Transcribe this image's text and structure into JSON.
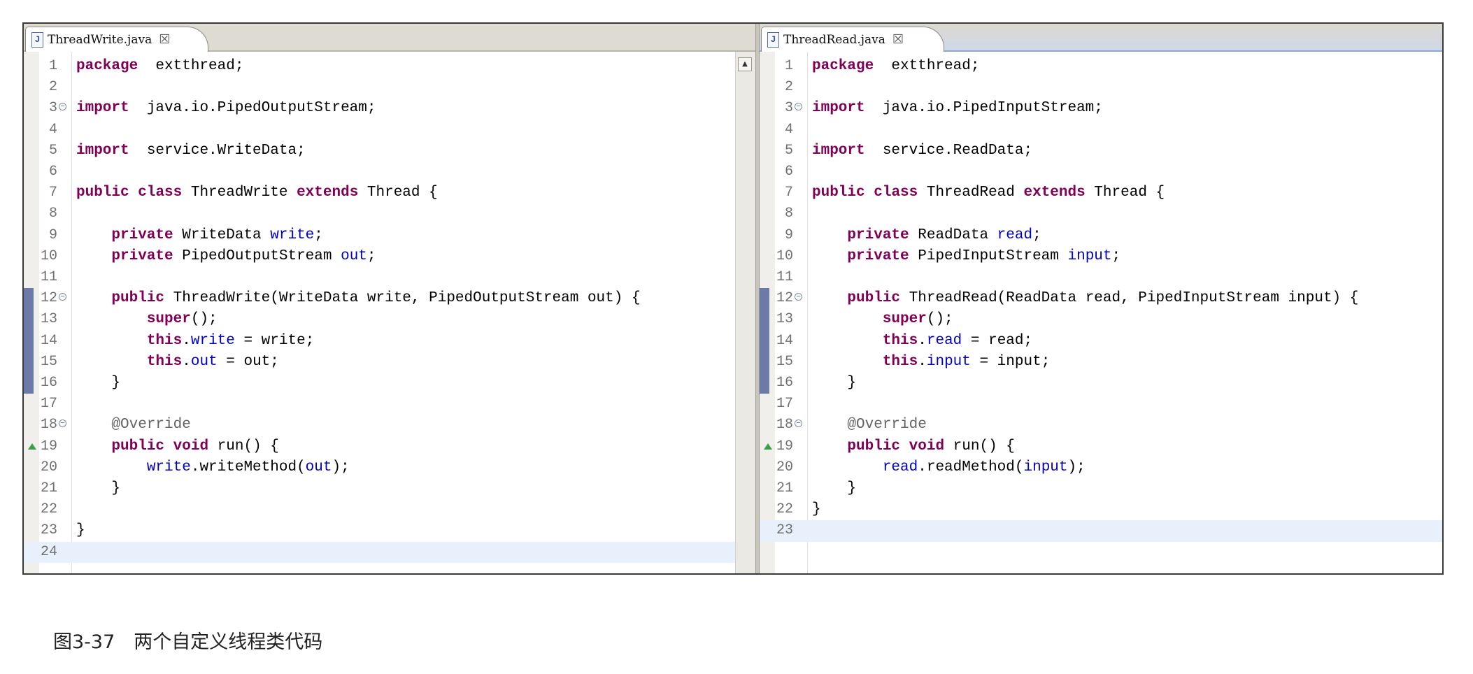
{
  "left": {
    "tab_label": "ThreadWrite.java",
    "file_icon": "java-file-icon",
    "lines": [
      [
        [
          "kw",
          "package"
        ],
        [
          "",
          "  extthread;"
        ]
      ],
      [],
      [
        [
          "kw",
          "import"
        ],
        [
          "",
          "  java.io.PipedOutputStream;"
        ]
      ],
      [],
      [
        [
          "kw",
          "import"
        ],
        [
          "",
          "  service.WriteData;"
        ]
      ],
      [],
      [
        [
          "kw",
          "public"
        ],
        [
          "",
          " "
        ],
        [
          "kw",
          "class"
        ],
        [
          "",
          " ThreadWrite "
        ],
        [
          "kw",
          "extends"
        ],
        [
          "",
          " Thread {"
        ]
      ],
      [],
      [
        [
          "",
          "    "
        ],
        [
          "kw",
          "private"
        ],
        [
          "",
          " WriteData "
        ],
        [
          "fld",
          "write"
        ],
        [
          "",
          ";"
        ]
      ],
      [
        [
          "",
          "    "
        ],
        [
          "kw",
          "private"
        ],
        [
          "",
          " PipedOutputStream "
        ],
        [
          "fld",
          "out"
        ],
        [
          "",
          ";"
        ]
      ],
      [],
      [
        [
          "",
          "    "
        ],
        [
          "kw",
          "public"
        ],
        [
          "",
          " ThreadWrite(WriteData write, PipedOutputStream out) {"
        ]
      ],
      [
        [
          "",
          "        "
        ],
        [
          "kw",
          "super"
        ],
        [
          "",
          "();"
        ]
      ],
      [
        [
          "",
          "        "
        ],
        [
          "kw",
          "this"
        ],
        [
          "",
          "."
        ],
        [
          "fld",
          "write"
        ],
        [
          "",
          " = write;"
        ]
      ],
      [
        [
          "",
          "        "
        ],
        [
          "kw",
          "this"
        ],
        [
          "",
          "."
        ],
        [
          "fld",
          "out"
        ],
        [
          "",
          " = out;"
        ]
      ],
      [
        [
          "",
          "    }"
        ]
      ],
      [],
      [
        [
          "",
          "    "
        ],
        [
          "ann",
          "@Override"
        ]
      ],
      [
        [
          "",
          "    "
        ],
        [
          "kw",
          "public"
        ],
        [
          "",
          " "
        ],
        [
          "kw",
          "void"
        ],
        [
          "",
          " run() {"
        ]
      ],
      [
        [
          "",
          "        "
        ],
        [
          "fld",
          "write"
        ],
        [
          "",
          ".writeMethod("
        ],
        [
          "fld",
          "out"
        ],
        [
          "",
          ");"
        ]
      ],
      [
        [
          "",
          "    }"
        ]
      ],
      [],
      [
        [
          "",
          "}"
        ]
      ],
      []
    ]
  },
  "right": {
    "tab_label": "ThreadRead.java",
    "file_icon": "java-file-icon",
    "lines": [
      [
        [
          "kw",
          "package"
        ],
        [
          "",
          "  extthread;"
        ]
      ],
      [],
      [
        [
          "kw",
          "import"
        ],
        [
          "",
          "  java.io.PipedInputStream;"
        ]
      ],
      [],
      [
        [
          "kw",
          "import"
        ],
        [
          "",
          "  service.ReadData;"
        ]
      ],
      [],
      [
        [
          "kw",
          "public"
        ],
        [
          "",
          " "
        ],
        [
          "kw",
          "class"
        ],
        [
          "",
          " ThreadRead "
        ],
        [
          "kw",
          "extends"
        ],
        [
          "",
          " Thread {"
        ]
      ],
      [],
      [
        [
          "",
          "    "
        ],
        [
          "kw",
          "private"
        ],
        [
          "",
          " ReadData "
        ],
        [
          "fld",
          "read"
        ],
        [
          "",
          ";"
        ]
      ],
      [
        [
          "",
          "    "
        ],
        [
          "kw",
          "private"
        ],
        [
          "",
          " PipedInputStream "
        ],
        [
          "fld",
          "input"
        ],
        [
          "",
          ";"
        ]
      ],
      [],
      [
        [
          "",
          "    "
        ],
        [
          "kw",
          "public"
        ],
        [
          "",
          " ThreadRead(ReadData read, PipedInputStream input) {"
        ]
      ],
      [
        [
          "",
          "        "
        ],
        [
          "kw",
          "super"
        ],
        [
          "",
          "();"
        ]
      ],
      [
        [
          "",
          "        "
        ],
        [
          "kw",
          "this"
        ],
        [
          "",
          "."
        ],
        [
          "fld",
          "read"
        ],
        [
          "",
          " = read;"
        ]
      ],
      [
        [
          "",
          "        "
        ],
        [
          "kw",
          "this"
        ],
        [
          "",
          "."
        ],
        [
          "fld",
          "input"
        ],
        [
          "",
          " = input;"
        ]
      ],
      [
        [
          "",
          "    }"
        ]
      ],
      [],
      [
        [
          "",
          "    "
        ],
        [
          "ann",
          "@Override"
        ]
      ],
      [
        [
          "",
          "    "
        ],
        [
          "kw",
          "public"
        ],
        [
          "",
          " "
        ],
        [
          "kw",
          "void"
        ],
        [
          "",
          " run() {"
        ]
      ],
      [
        [
          "",
          "        "
        ],
        [
          "fld",
          "read"
        ],
        [
          "",
          ".readMethod("
        ],
        [
          "fld",
          "input"
        ],
        [
          "",
          ");"
        ]
      ],
      [
        [
          "",
          "    }"
        ]
      ],
      [
        [
          "",
          "}"
        ]
      ],
      []
    ]
  },
  "fold_markers": [
    3,
    12,
    18
  ],
  "override_markers": [
    19
  ],
  "change_bar_lines": [
    12,
    16
  ],
  "colors": {
    "keyword": "#7f0055",
    "field": "#0000c0",
    "annotation": "#646464",
    "current_line": "#e8f0fb"
  },
  "caption": "图3-37　两个自定义线程类代码"
}
